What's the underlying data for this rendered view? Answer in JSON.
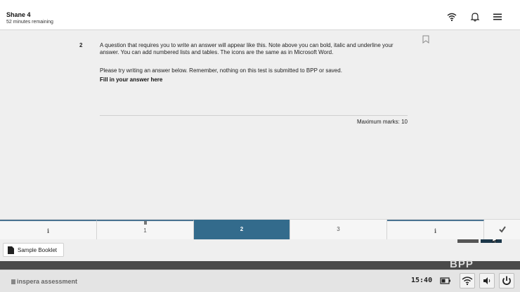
{
  "header": {
    "candidate_name": "Shane 4",
    "time_remaining": "52 minutes remaining"
  },
  "question": {
    "number": "2",
    "text_paragraph_1": "A question that requires you to write an answer will appear like this.  Note above you can bold, italic and underline your answer.  You can add numbered lists and tables.  The icons are the same as in Microsoft Word.",
    "text_paragraph_2": "Please try writing an answer below.  Remember, nothing on this test is submitted to BPP or saved.",
    "answer_prompt": "Fill in your answer here",
    "max_marks": "Maximum marks: 10"
  },
  "tabs": [
    {
      "label": "i",
      "kind": "info"
    },
    {
      "label": "1",
      "kind": "question"
    },
    {
      "label": "2",
      "kind": "question",
      "active": true
    },
    {
      "label": "3",
      "kind": "question"
    },
    {
      "label": "i",
      "kind": "info"
    }
  ],
  "booklet": {
    "label": "Sample Booklet"
  },
  "footer": {
    "brand_logo": "BPP",
    "inspera_logo": "inspera assessment",
    "clock": "15:40"
  },
  "icons": {
    "wifi": "wifi-icon",
    "bell": "bell-icon",
    "menu": "hamburger-menu-icon",
    "bookmark": "bookmark-icon",
    "prev": "chevron-left-icon",
    "next": "chevron-right-icon",
    "submit": "checkmark-icon",
    "document": "document-icon",
    "battery": "battery-icon",
    "volume": "speaker-icon",
    "power": "power-icon"
  },
  "colors": {
    "active_tab": "#336b8c",
    "next_button": "#1c3749",
    "prev_button": "#555555"
  }
}
